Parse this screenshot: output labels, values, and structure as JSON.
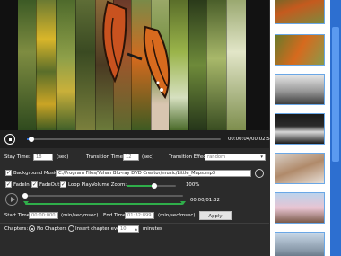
{
  "playback": {
    "time": "00:00:04/00:02:52",
    "progress": 0.025
  },
  "settings": {
    "stay_time_label": "Stay Time:",
    "stay_time_value": "18",
    "stay_time_unit": "(sec)",
    "transition_time_label": "Transition Time:",
    "transition_time_value": "12",
    "transition_time_unit": "(sec)",
    "transition_effect_label": "Transition Effect:",
    "transition_effect_value": "random",
    "background_music_label": "Background Music:",
    "background_music_checked": true,
    "background_music_path": "C:/Program Files/Yuhan Blu-ray DVD Creator/music/Little_Maps.mp3",
    "fadein_label": "FadeIn",
    "fadein_checked": true,
    "fadeout_label": "FadeOut",
    "fadeout_checked": true,
    "loop_play_label": "Loop Play",
    "loop_play_checked": true,
    "volume_label": "Volume Zoom:",
    "volume_percent": "100%",
    "volume_fraction": 0.55,
    "music_time": "00:00/01:32",
    "music_progress": 0.0,
    "start_time_label": "Start Time:",
    "start_time_value": "00:00:000",
    "start_time_unit": "(min/sec/msec)",
    "end_time_label": "End Time:",
    "end_time_value": "01:32:899",
    "end_time_unit": "(min/sec/msec)",
    "apply_label": "Apply",
    "chapters_label": "Chapters:",
    "no_chapters_label": "No Chapters",
    "insert_chapter_label": "Insert chapter every",
    "chapter_minutes_value": "10",
    "minutes_label": "minutes"
  },
  "colors": {
    "accent": "#2f6fd6",
    "scrollbar": "#2d6fd0",
    "volume_green": "#2fae4a"
  },
  "thumbnails": [
    {
      "name": "butterfly-orange"
    },
    {
      "name": "butterfly-orange-2"
    },
    {
      "name": "bench"
    },
    {
      "name": "white-car"
    },
    {
      "name": "cat"
    },
    {
      "name": "cherry-blossom"
    },
    {
      "name": "city"
    }
  ]
}
